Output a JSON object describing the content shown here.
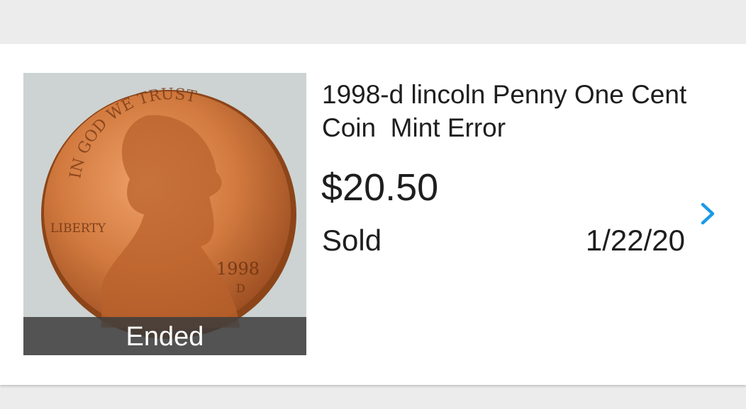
{
  "listing": {
    "thumbnail_alt": "penny-coin-photo",
    "coin_rim_top_text": "IN GOD WE TRUST",
    "coin_left_text": "LIBERTY",
    "coin_year": "1998",
    "coin_mint": "D",
    "badge": "Ended",
    "title": "1998-d lincoln Penny One Cent Coin  Mint Error",
    "price": "$20.50",
    "status": "Sold",
    "date": "1/22/20",
    "chevron_icon": "chevron-right-icon"
  },
  "colors": {
    "accent": "#1a9be6",
    "text": "#1e1e1e",
    "background": "#ececec",
    "card": "#ffffff"
  }
}
